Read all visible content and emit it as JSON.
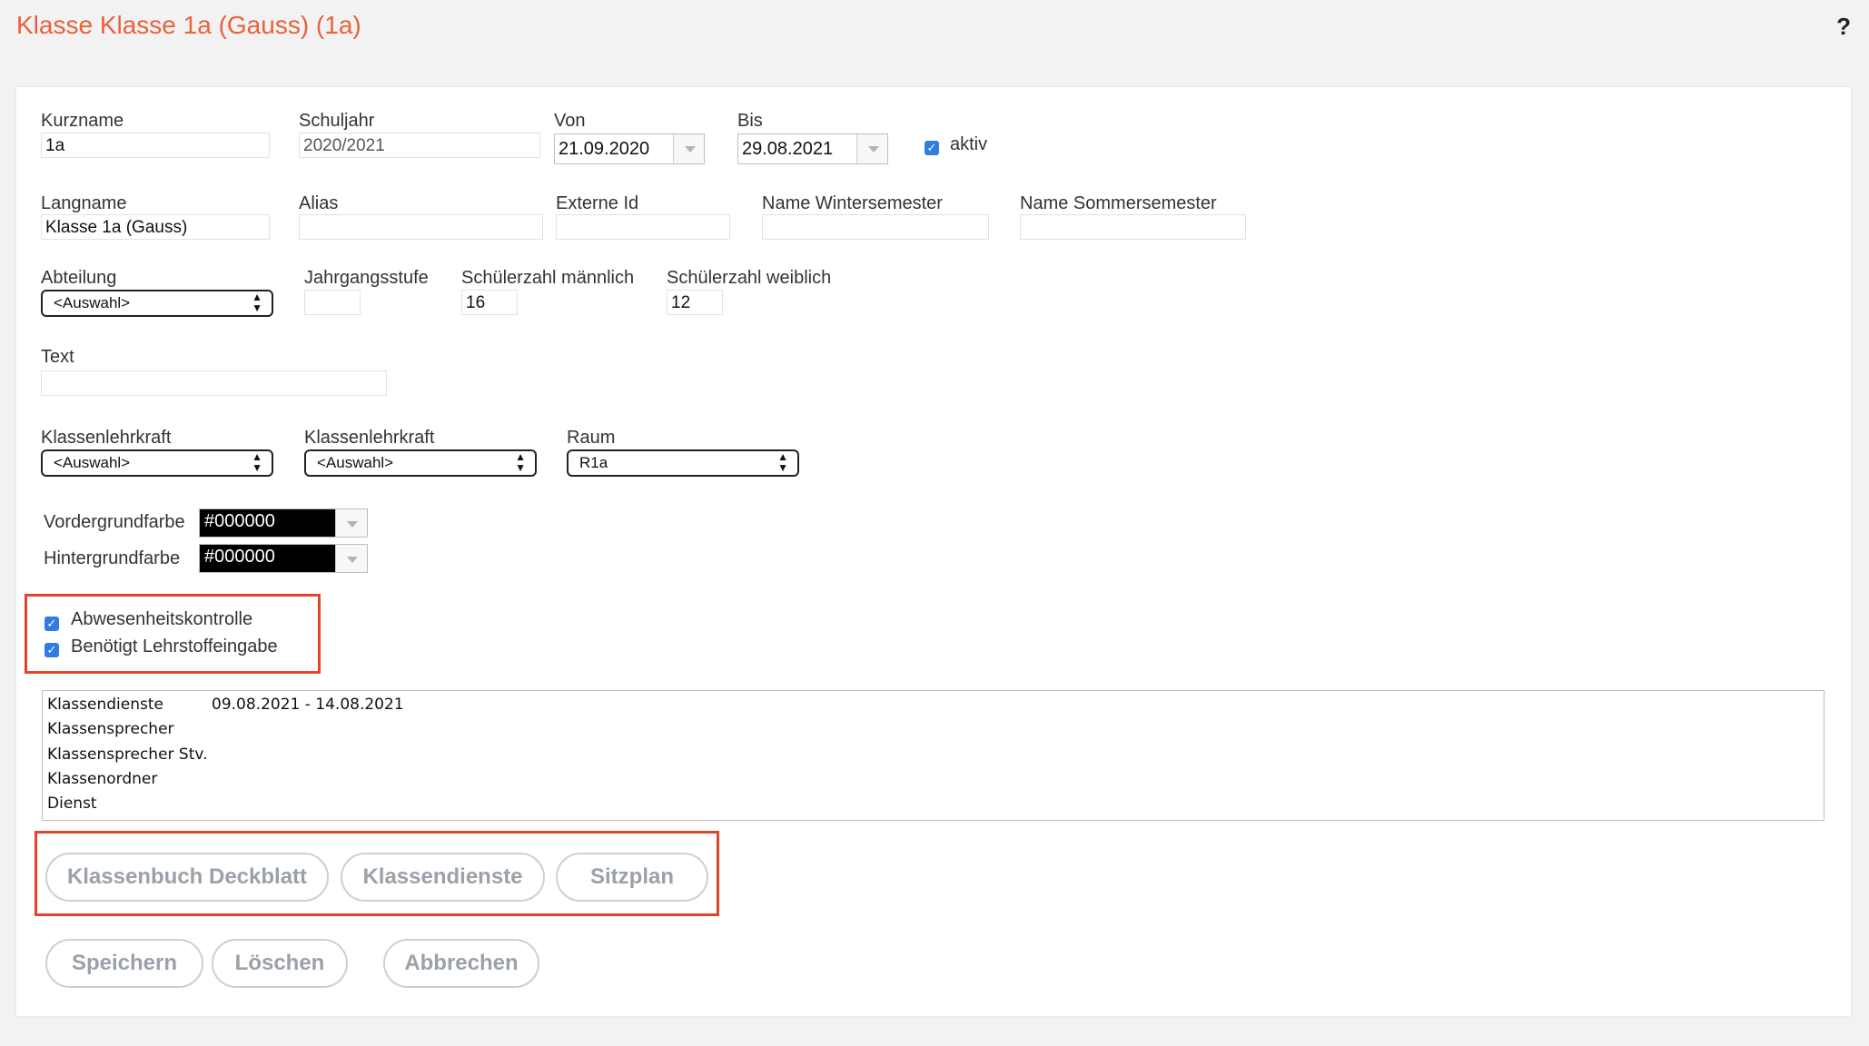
{
  "page": {
    "title": "Klasse Klasse 1a (Gauss) (1a)",
    "help": "?"
  },
  "form": {
    "kurzname": {
      "label": "Kurzname",
      "value": "1a"
    },
    "schuljahr": {
      "label": "Schuljahr",
      "value": "2020/2021"
    },
    "von": {
      "label": "Von",
      "value": "21.09.2020"
    },
    "bis": {
      "label": "Bis",
      "value": "29.08.2021"
    },
    "aktiv": {
      "label": "aktiv",
      "checked": true
    },
    "langname": {
      "label": "Langname",
      "value": "Klasse 1a (Gauss)"
    },
    "alias": {
      "label": "Alias",
      "value": ""
    },
    "externe_id": {
      "label": "Externe Id",
      "value": ""
    },
    "name_winter": {
      "label": "Name Wintersemester",
      "value": ""
    },
    "name_sommer": {
      "label": "Name Sommersemester",
      "value": ""
    },
    "abteilung": {
      "label": "Abteilung",
      "value": "<Auswahl>"
    },
    "jahrgangsstufe": {
      "label": "Jahrgangsstufe",
      "value": ""
    },
    "schueler_m": {
      "label": "Schülerzahl männlich",
      "value": "16"
    },
    "schueler_w": {
      "label": "Schülerzahl weiblich",
      "value": "12"
    },
    "text": {
      "label": "Text",
      "value": ""
    },
    "klassenlehrkraft1": {
      "label": "Klassenlehrkraft",
      "value": "<Auswahl>"
    },
    "klassenlehrkraft2": {
      "label": "Klassenlehrkraft",
      "value": "<Auswahl>"
    },
    "raum": {
      "label": "Raum",
      "value": "R1a"
    },
    "vordergrundfarbe": {
      "label": "Vordergrundfarbe",
      "value": "#000000"
    },
    "hintergrundfarbe": {
      "label": "Hintergrundfarbe",
      "value": "#000000"
    },
    "abwesenheitskontrolle": {
      "label": "Abwesenheitskontrolle",
      "checked": true
    },
    "lehrstoff": {
      "label": "Benötigt Lehrstoffeingabe",
      "checked": true
    }
  },
  "duties": [
    {
      "label": "Klassendienste",
      "value": "09.08.2021 - 14.08.2021"
    },
    {
      "label": "Klassensprecher",
      "value": ""
    },
    {
      "label": "Klassensprecher Stv.",
      "value": ""
    },
    {
      "label": "Klassenordner",
      "value": ""
    },
    {
      "label": "Dienst",
      "value": ""
    }
  ],
  "buttons": {
    "deckblatt": "Klassenbuch Deckblatt",
    "klassendienste": "Klassendienste",
    "sitzplan": "Sitzplan",
    "speichern": "Speichern",
    "loeschen": "Löschen",
    "abbrechen": "Abbrechen"
  },
  "colors": {
    "accent": "#e8623b",
    "highlight_box": "#e2452b",
    "checkbox": "#2f7de1"
  }
}
